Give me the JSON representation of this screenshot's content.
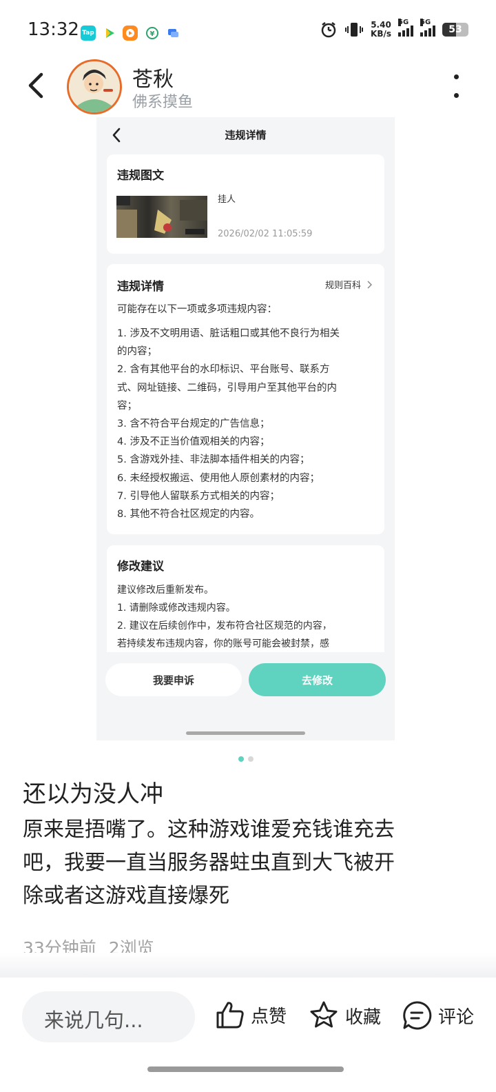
{
  "status_bar": {
    "time": "13:32",
    "apps": [
      "Tap",
      "",
      "",
      "",
      ""
    ],
    "net_speed_value": "5.40",
    "net_speed_unit": "KB/s",
    "signal1": "5G",
    "signal2": "5G",
    "battery_level": "53"
  },
  "header": {
    "user_name": "苍秋",
    "user_subtitle": "佛系摸鱼"
  },
  "screenshot": {
    "title": "违规详情",
    "post_card": {
      "heading": "违规图文",
      "text": "挂人",
      "timestamp": "2026/02/02 11:05:59"
    },
    "detail_card": {
      "heading": "违规详情",
      "rules_link": "规则百科",
      "intro": "可能存在以下一项或多项违规内容：",
      "items": [
        "1. 涉及不文明用语、脏话粗口或其他不良行为相关",
        "的内容；",
        "2. 含有其他平台的水印标识、平台账号、联系方",
        "式、网址链接、二维码，引导用户至其他平台的内",
        "容；",
        "3. 含不符合平台规定的广告信息；",
        "4. 涉及不正当价值观相关的内容；",
        "5. 含游戏外挂、非法脚本插件相关的内容；",
        "6. 未经授权搬运、使用他人原创素材的内容；",
        "7. 引导他人留联系方式相关的内容；",
        "8. 其他不符合社区规定的内容。"
      ]
    },
    "suggest_card": {
      "heading": "修改建议",
      "lines": [
        "建议修改后重新发布。",
        "1. 请删除或修改违规内容。",
        "2. 建议在后续创作中，发布符合社区规范的内容，",
        "若持续发布违规内容，你的账号可能会被封禁，感"
      ]
    },
    "appeal_button": "我要申诉",
    "edit_button": "去修改"
  },
  "pager": {
    "count": 2,
    "active": 0
  },
  "post": {
    "title": "还以为没人冲",
    "body_lines": [
      "原来是捂嘴了。这种游戏谁爱充钱谁充去",
      "吧，我要一直当服务器蛀虫直到大飞被开",
      "除或者这游戏直接爆死"
    ],
    "time_ago": "33分钟前",
    "views": "2浏览"
  },
  "bottom_bar": {
    "comment_placeholder": "来说几句...",
    "like_label": "点赞",
    "favorite_label": "收藏",
    "comment_label": "评论"
  },
  "colors": {
    "accent": "#5fd3c0",
    "avatar_ring": "#e56c2a"
  }
}
